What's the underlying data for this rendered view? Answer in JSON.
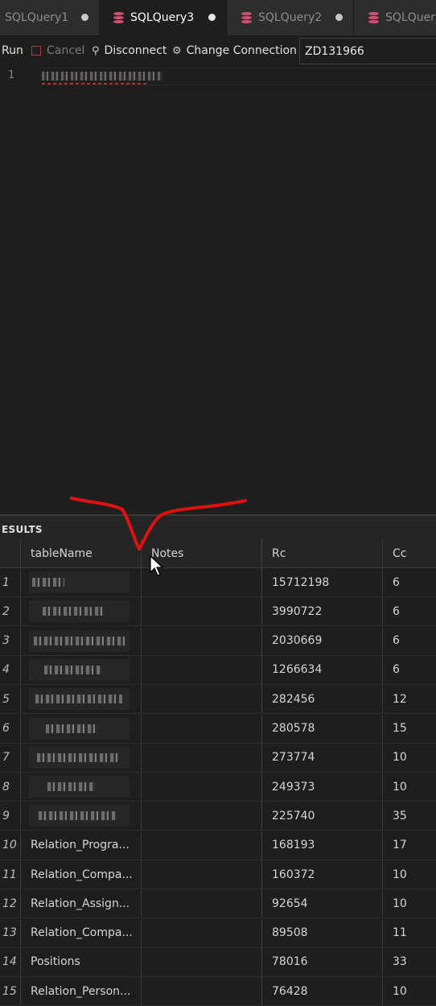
{
  "tabs": [
    {
      "label": "SQLQuery1",
      "active": false
    },
    {
      "label": "SQLQuery3",
      "active": true
    },
    {
      "label": "SQLQuery2",
      "active": false
    },
    {
      "label": "SQLQuery4",
      "active": false
    }
  ],
  "toolbar": {
    "run_label": "Run",
    "cancel_label": "Cancel",
    "disconnect_label": "Disconnect",
    "change_connection_label": "Change Connection",
    "connection_value": "ZD131966"
  },
  "editor": {
    "line_number": "1"
  },
  "results": {
    "title": "ESULTS",
    "columns": [
      "",
      "tableName",
      "Notes",
      "Rc",
      "Cc"
    ],
    "rows": [
      {
        "idx": "1",
        "tableName": "",
        "notes": "",
        "rc": "15712198",
        "cc": "6"
      },
      {
        "idx": "2",
        "tableName": "",
        "notes": "",
        "rc": "3990722",
        "cc": "6"
      },
      {
        "idx": "3",
        "tableName": "",
        "notes": "",
        "rc": "2030669",
        "cc": "6"
      },
      {
        "idx": "4",
        "tableName": "",
        "notes": "",
        "rc": "1266634",
        "cc": "6"
      },
      {
        "idx": "5",
        "tableName": "",
        "notes": "",
        "rc": "282456",
        "cc": "12"
      },
      {
        "idx": "6",
        "tableName": "",
        "notes": "",
        "rc": "280578",
        "cc": "15"
      },
      {
        "idx": "7",
        "tableName": "",
        "notes": "",
        "rc": "273774",
        "cc": "10"
      },
      {
        "idx": "8",
        "tableName": "",
        "notes": "",
        "rc": "249373",
        "cc": "10"
      },
      {
        "idx": "9",
        "tableName": "",
        "notes": "",
        "rc": "225740",
        "cc": "35"
      },
      {
        "idx": "10",
        "tableName": "Relation_Progra...",
        "notes": "",
        "rc": "168193",
        "cc": "17"
      },
      {
        "idx": "11",
        "tableName": "Relation_Compa...",
        "notes": "",
        "rc": "160372",
        "cc": "10"
      },
      {
        "idx": "12",
        "tableName": "Relation_Assign...",
        "notes": "",
        "rc": "92654",
        "cc": "10"
      },
      {
        "idx": "13",
        "tableName": "Relation_Compa...",
        "notes": "",
        "rc": "89508",
        "cc": "11"
      },
      {
        "idx": "14",
        "tableName": "Positions",
        "notes": "",
        "rc": "78016",
        "cc": "33"
      },
      {
        "idx": "15",
        "tableName": "Relation_Person...",
        "notes": "",
        "rc": "76428",
        "cc": "10"
      }
    ]
  },
  "colors": {
    "db_icon": "#d64f72",
    "annotation": "#e01010",
    "background": "#1e1e1e"
  }
}
